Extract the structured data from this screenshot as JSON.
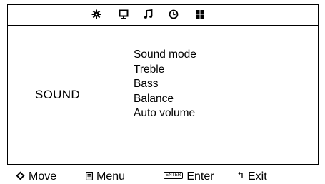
{
  "top_icons": [
    {
      "icon": "picture-icon"
    },
    {
      "icon": "screen-icon"
    },
    {
      "icon": "sound-icon"
    },
    {
      "icon": "clock-icon"
    },
    {
      "icon": "apps-icon"
    }
  ],
  "category": "SOUND",
  "menu_items": [
    {
      "label": "Sound mode"
    },
    {
      "label": "Treble"
    },
    {
      "label": "Bass"
    },
    {
      "label": "Balance"
    },
    {
      "label": "Auto volume"
    }
  ],
  "nav": {
    "move_label": "Move",
    "move_icon": "four-way-arrow-icon",
    "menu_label": "Menu",
    "menu_icon": "menu-key-icon",
    "enter_key": "ENTER",
    "enter_label": "Enter",
    "exit_label": "Exit",
    "exit_icon": "return-arrow-icon"
  }
}
